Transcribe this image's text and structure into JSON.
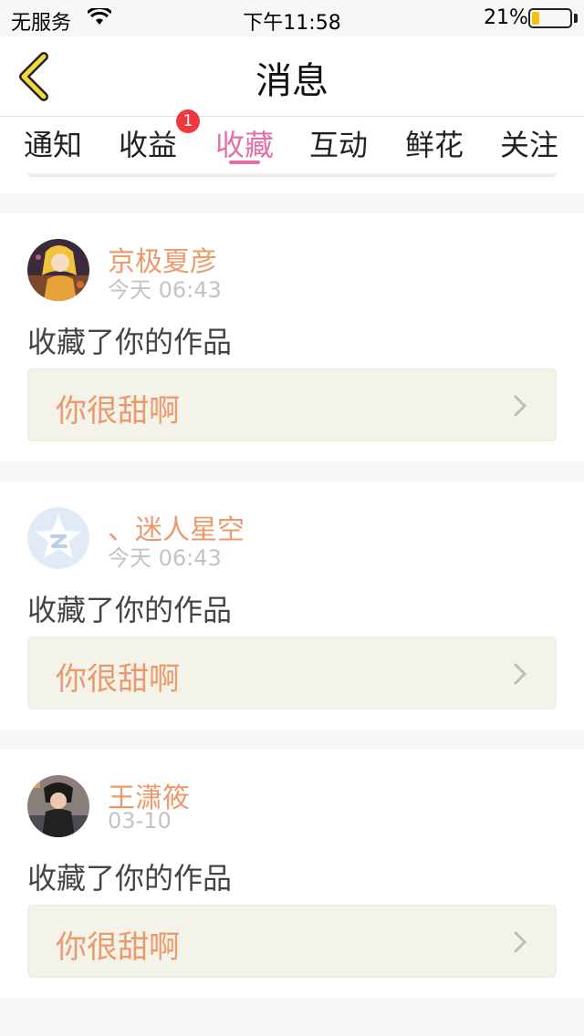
{
  "status_bar": {
    "carrier": "无服务",
    "time": "下午11:58",
    "battery_pct": "21%",
    "battery_level": 0.21,
    "icons": [
      "wifi-icon",
      "battery-icon"
    ],
    "battery_color": "#f4c20d"
  },
  "nav": {
    "title": "消息",
    "back_icon": "chevron-left-icon",
    "back_color": "#f4c20d"
  },
  "tabs": {
    "items": [
      {
        "label": "通知"
      },
      {
        "label": "收益",
        "badge": "1"
      },
      {
        "label": "收藏",
        "active": true
      },
      {
        "label": "互动"
      },
      {
        "label": "鲜花"
      },
      {
        "label": "关注"
      }
    ],
    "active_color": "#e46fa8",
    "badge_color": "#f0383f"
  },
  "messages": [
    {
      "user": "京极夏彦",
      "time": "今天 06:43",
      "action": "收藏了你的作品",
      "work_title": "你很甜啊",
      "avatar": "anime-avatar"
    },
    {
      "user": "、迷人星空",
      "time": "今天 06:43",
      "action": "收藏了你的作品",
      "work_title": "你很甜啊",
      "avatar": "default-qzone-avatar"
    },
    {
      "user": "王潇筱",
      "time": "03-10",
      "action": "收藏了你的作品",
      "work_title": "你很甜啊",
      "avatar": "photo-avatar"
    }
  ],
  "colors": {
    "username": "#ec9a6c",
    "work_title": "#ec9a6c",
    "work_box_bg": "#f3f3ea"
  }
}
